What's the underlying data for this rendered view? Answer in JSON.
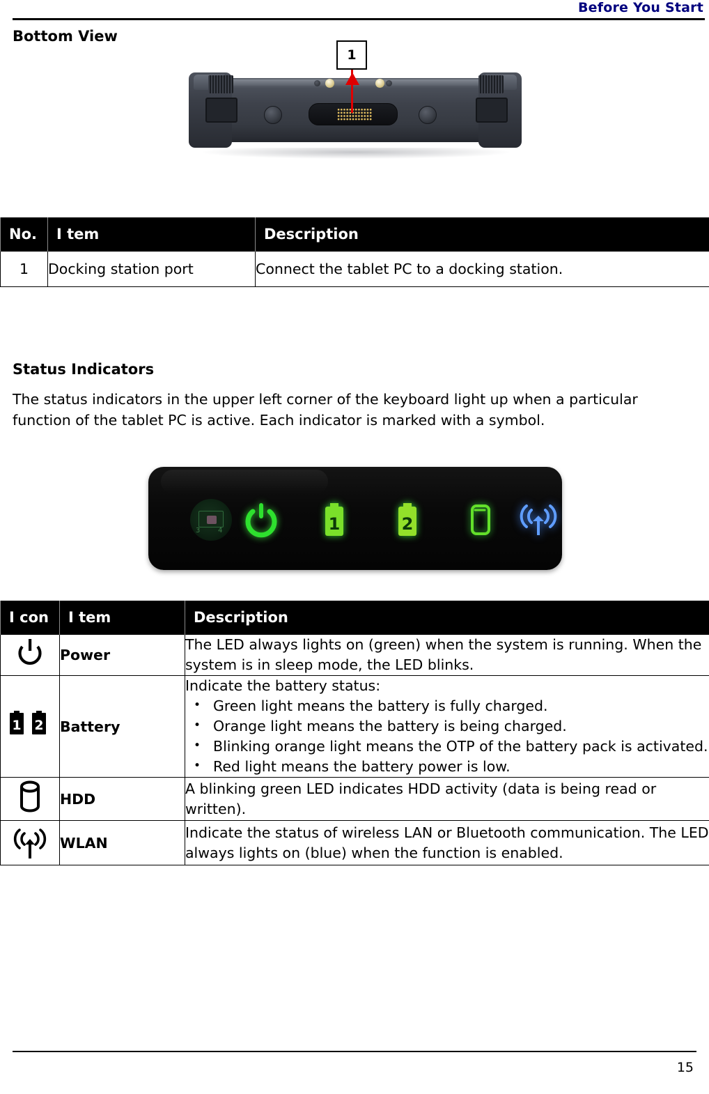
{
  "header": {
    "title": "Before You Start"
  },
  "sections": {
    "bottom_view_heading": "Bottom View",
    "status_indicators_heading": "Status Indicators",
    "status_indicators_intro": "The status indicators in the upper left corner of the keyboard light up when a particular function of the tablet PC is active. Each indicator is marked with a symbol."
  },
  "bottom_view_photo": {
    "callout_number": "1",
    "alt": "Bottom edge view of rugged tablet PC showing docking station port",
    "arrow_color": "#e00000"
  },
  "led_panel_photo": {
    "alt": "Status indicator LED panel",
    "indicators": [
      {
        "name": "sensor",
        "label": "",
        "color": "#1c4a28"
      },
      {
        "name": "power",
        "label": "",
        "color": "#2ecc2e"
      },
      {
        "name": "battery-1",
        "label": "1",
        "color": "#6fe02a"
      },
      {
        "name": "battery-2",
        "label": "2",
        "color": "#8ce02a"
      },
      {
        "name": "hdd",
        "label": "",
        "color": "#5ae02a"
      },
      {
        "name": "wlan",
        "label": "",
        "color": "#4b8dff"
      }
    ]
  },
  "table_bottom_view": {
    "columns": [
      "No.",
      "I tem",
      "Description"
    ],
    "rows": [
      {
        "no": "1",
        "item": "Docking station port",
        "description": "Connect the tablet PC to a docking station."
      }
    ]
  },
  "table_status_indicators": {
    "columns": [
      "I con",
      "I tem",
      "Description"
    ],
    "rows": [
      {
        "icon": "power-icon",
        "item": "Power",
        "description": "The LED always lights on (green) when the system is running. When the system is in sleep mode, the LED blinks.",
        "bullets": []
      },
      {
        "icon": "battery-icon",
        "item": "Battery",
        "description": "Indicate the battery status:",
        "bullets": [
          "Green light means the battery is fully charged.",
          "Orange light means the battery is being charged.",
          "Blinking orange light means the OTP of the battery pack is activated.",
          "Red light means the battery power is low."
        ]
      },
      {
        "icon": "hdd-icon",
        "item": "HDD",
        "description": "A blinking green LED indicates HDD activity (data is being read or written).",
        "bullets": []
      },
      {
        "icon": "wlan-icon",
        "item": "WLAN",
        "description": "Indicate the status of wireless LAN or Bluetooth communication. The LED always lights on (blue) when the function is enabled.",
        "bullets": []
      }
    ]
  },
  "footer": {
    "page_number": "15"
  },
  "colors": {
    "header_blue": "#00007e",
    "table_header_bg": "#000000",
    "table_header_text": "#ffffff",
    "callout_red": "#e00000"
  }
}
